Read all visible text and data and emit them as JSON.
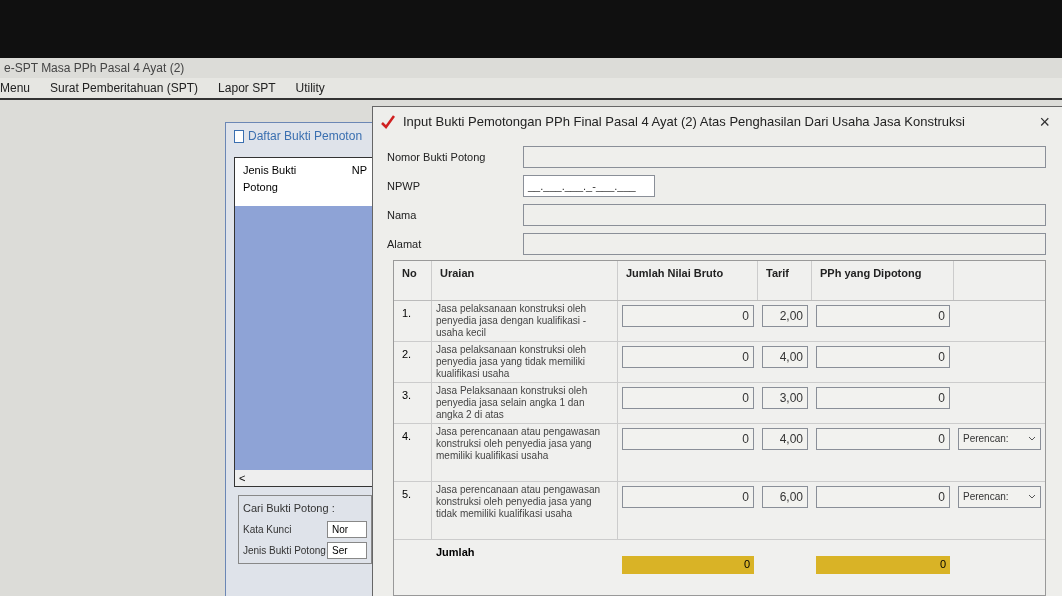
{
  "app": {
    "title": "e-SPT Masa PPh Pasal 4 Ayat (2)"
  },
  "menu": [
    "Menu",
    "Surat Pemberitahuan (SPT)",
    "Lapor SPT",
    "Utility"
  ],
  "back_window": {
    "title": "Daftar Bukti Pemoton",
    "columns": [
      "Jenis Bukti Potong",
      "NP"
    ],
    "scroll_left": "<",
    "search_group": "Cari Bukti Potong :",
    "fields": [
      {
        "label": "Kata Kunci",
        "value": "Nor"
      },
      {
        "label": "Jenis Bukti Potong",
        "value": "Ser"
      }
    ]
  },
  "dialog": {
    "title": "Input Bukti Pemotongan PPh Final Pasal 4 Ayat (2) Atas Penghasilan Dari Usaha Jasa Konstruksi",
    "close": "×",
    "fields": [
      {
        "label": "Nomor Bukti Potong"
      },
      {
        "label": "NPWP",
        "value": "__.___.___._-___.___",
        "kind": "masked"
      },
      {
        "label": "Nama"
      },
      {
        "label": "Alamat"
      }
    ],
    "table": {
      "columns": [
        "No",
        "Uraian",
        "Jumlah Nilai Bruto",
        "Tarif",
        "PPh yang Dipotong"
      ],
      "rows": [
        {
          "no": "1.",
          "uraian": "Jasa pelaksanaan konstruksi oleh penyedia jasa dengan kualifikasi -usaha kecil",
          "bruto": "0",
          "tarif": "2,00",
          "pph": "0"
        },
        {
          "no": "2.",
          "uraian": "Jasa pelaksanaan konstruksi oleh penyedia jasa yang tidak memiliki kualifikasi usaha",
          "bruto": "0",
          "tarif": "4,00",
          "pph": "0"
        },
        {
          "no": "3.",
          "uraian": "Jasa Pelaksanaan konstruksi oleh penyedia jasa selain angka 1 dan angka 2 di atas",
          "bruto": "0",
          "tarif": "3,00",
          "pph": "0"
        },
        {
          "no": "4.",
          "uraian": "Jasa perencanaan atau pengawasan konstruksi oleh penyedia jasa yang memiliki kualifikasi usaha",
          "bruto": "0",
          "tarif": "4,00",
          "pph": "0",
          "option": "Perencan:"
        },
        {
          "no": "5.",
          "uraian": "Jasa perencanaan atau pengawasan konstruksi oleh penyedia jasa yang tidak memiliki kualifikasi usaha",
          "bruto": "0",
          "tarif": "6,00",
          "pph": "0",
          "option": "Perencan:"
        }
      ],
      "total": {
        "label": "Jumlah",
        "bruto": "0",
        "pph": "0"
      }
    }
  }
}
